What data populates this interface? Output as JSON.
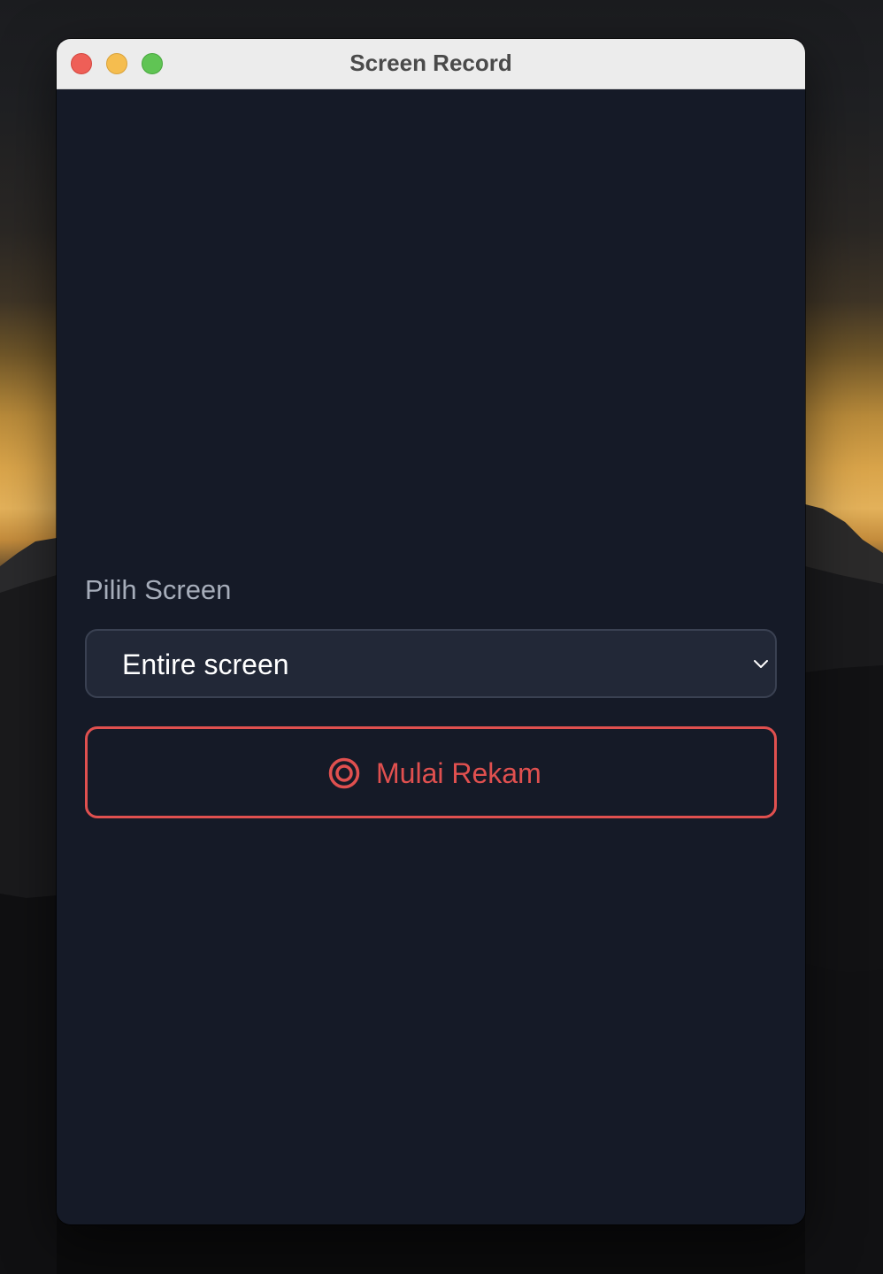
{
  "window": {
    "title": "Screen Record"
  },
  "form": {
    "label": "Pilih Screen",
    "select": {
      "value": "Entire screen"
    },
    "record_button": {
      "label": "Mulai Rekam",
      "icon": "record-icon"
    }
  },
  "colors": {
    "window_bg": "#151a27",
    "select_bg": "#222837",
    "accent_red": "#e0504f",
    "label_gray": "#a6adba",
    "titlebar_bg": "#ececec"
  }
}
